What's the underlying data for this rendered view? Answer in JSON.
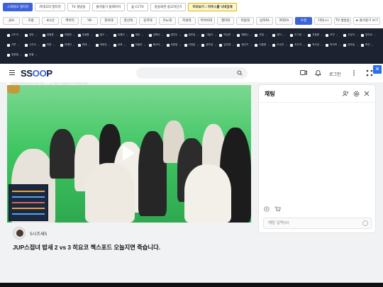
{
  "toolbar": {
    "row1": [
      {
        "label": "스테레오 멀티뷰",
        "style": "blue"
      },
      {
        "label": "카테고리 멀티뷰",
        "style": ""
      },
      {
        "label": "TV 생방송",
        "style": ""
      },
      {
        "label": "즐겨찾기 플레이어",
        "style": ""
      },
      {
        "label": "숲 CCTV",
        "style": ""
      },
      {
        "label": "방송화면 광고차단기",
        "style": ""
      },
      {
        "label": "미리보기 : 마우스를 낙네임에",
        "style": "yellow"
      }
    ],
    "row2": [
      {
        "label": "JSA",
        "active": false
      },
      {
        "label": "조합",
        "active": false
      },
      {
        "label": "4나선",
        "active": false
      },
      {
        "label": "케이티",
        "active": false
      },
      {
        "label": "YB",
        "active": false
      },
      {
        "label": "정육대",
        "active": false
      },
      {
        "label": "창선대",
        "active": false
      },
      {
        "label": "동지대",
        "active": false
      },
      {
        "label": "이노대",
        "active": false
      },
      {
        "label": "저성대",
        "active": false
      },
      {
        "label": "흑커비대",
        "active": false
      },
      {
        "label": "캡티대",
        "active": false
      },
      {
        "label": "미림대",
        "active": false
      },
      {
        "label": "남자FA",
        "active": false
      },
      {
        "label": "여자FA",
        "active": false
      },
      {
        "label": "수정",
        "active": true
      },
      {
        "label": "기타(+)",
        "active": false
      },
      {
        "label": "TV 생방송",
        "active": false
      },
      {
        "label": "★ 즐겨찾기 보기",
        "active": false,
        "fav": true
      }
    ]
  },
  "channels": [
    "시드석",
    "강민",
    "정봉훈",
    "이영한",
    "정생용",
    "철구",
    "씨웨이",
    "재비",
    "김택이",
    "정진두",
    "염보성",
    "기늘다",
    "박상진",
    "혜레나",
    "큰빛",
    "엔다",
    "도기성",
    "안동환",
    "초빈",
    "신성식",
    "영진숙",
    "거루",
    "시가사",
    "하준",
    "이재천",
    "변태",
    "박태진",
    "큐레",
    "박솔빈",
    "페스터",
    "추현영",
    "이영호",
    "윤민성",
    "임진영",
    "정인기",
    "이종원",
    "이수빈",
    "조근석",
    "박주성",
    "박지미",
    "김하늘",
    "박진",
    "장윤철",
    "한결"
  ],
  "channels_extra": [
    "체크된 4개부터 동시 시청 가능",
    "클릭 시 즐겨찾기 보기에 추가됨"
  ],
  "header": {
    "logo_a": "S",
    "logo_o1": "O",
    "logo_o2": "O",
    "logo_p": "P",
    "login": "로그인",
    "ad_close": "✕"
  },
  "stream": {
    "streamer_name": "S시조새S",
    "title": "JUP스접녀 밥새 2 vs 3 히요코 첵스포드 오늘지면 죽습니다."
  },
  "chat": {
    "title": "채팅",
    "input_placeholder": "채팅 입력(0)"
  },
  "colors": {
    "accent": "#3d63d8",
    "chroma": "#49d16e",
    "dark_strip": "#1d2230"
  }
}
